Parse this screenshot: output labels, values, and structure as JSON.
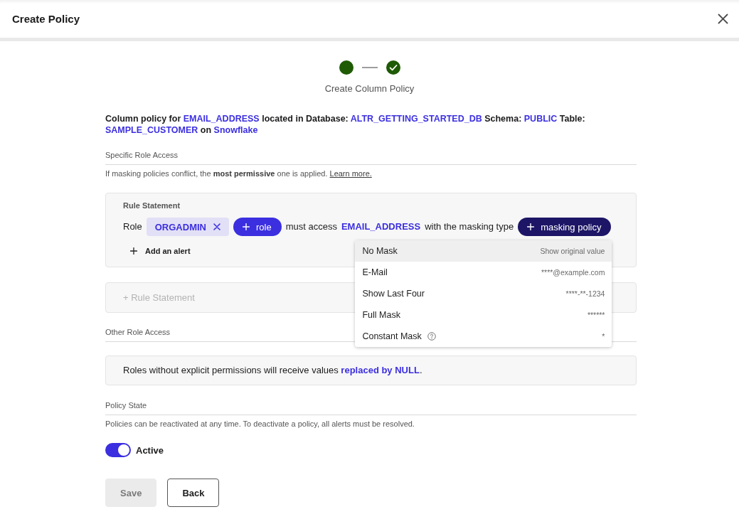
{
  "dialog": {
    "title": "Create Policy"
  },
  "stepper": {
    "steps": [
      {
        "done": false
      },
      {
        "done": true
      }
    ],
    "caption": "Create Column Policy"
  },
  "summary": [
    {
      "kind": "text",
      "text": "Column policy for "
    },
    {
      "kind": "value",
      "text": "EMAIL_ADDRESS"
    },
    {
      "kind": "text",
      "text": " located in Database: "
    },
    {
      "kind": "value",
      "text": "ALTR_GETTING_STARTED_DB"
    },
    {
      "kind": "text",
      "text": " Schema: "
    },
    {
      "kind": "value",
      "text": "PUBLIC"
    },
    {
      "kind": "text",
      "text": " Table: "
    },
    {
      "kind": "value",
      "text": "SAMPLE_CUSTOMER"
    },
    {
      "kind": "text",
      "text": " on "
    },
    {
      "kind": "value",
      "text": "Snowflake"
    }
  ],
  "specific_role_access": {
    "heading": "Specific Role Access",
    "note": "If masking policies conflict, the **most permissive** one is applied.",
    "link": "Learn more.",
    "rule_statement": {
      "label": "Rule Statement",
      "sentence": [
        {
          "kind": "text",
          "text": "Role"
        },
        {
          "kind": "chip",
          "text": "ORGADMIN"
        },
        {
          "kind": "add",
          "text": "role",
          "expanded": false
        },
        {
          "kind": "text",
          "text": "must access"
        },
        {
          "kind": "value",
          "text": "EMAIL_ADDRESS"
        },
        {
          "kind": "text",
          "text": "with the masking type"
        },
        {
          "kind": "add",
          "text": "masking policy",
          "expanded": true,
          "menu": [
            {
              "label": "No Mask",
              "example": "Show original value",
              "highlighted": true,
              "help": false
            },
            {
              "label": "E-Mail",
              "example": "****@example.com",
              "highlighted": false,
              "help": false
            },
            {
              "label": "Show Last Four",
              "example": "****-**-1234",
              "highlighted": false,
              "help": false
            },
            {
              "label": "Full Mask",
              "example": "******",
              "highlighted": false,
              "help": false
            },
            {
              "label": "Constant Mask",
              "example": "*",
              "highlighted": false,
              "help": true
            }
          ]
        }
      ],
      "add_alert": "Add an alert"
    },
    "add_rule": {
      "label": "+ Rule Statement",
      "disabled": true
    }
  },
  "other_role_access": {
    "heading": "Other Role Access",
    "message": [
      {
        "kind": "text",
        "text": "Roles without explicit permissions will receive values "
      },
      {
        "kind": "value",
        "text": "replaced by NULL"
      },
      {
        "kind": "text",
        "text": "."
      }
    ]
  },
  "policy_state": {
    "heading": "Policy State",
    "note": "Policies can be reactivated at any time. To deactivate a policy, all alerts must be resolved.",
    "toggle": {
      "label": "Active",
      "on": true
    }
  },
  "buttons": [
    {
      "label": "Save",
      "kind": "primary",
      "disabled": true
    },
    {
      "label": "Back",
      "kind": "secondary",
      "disabled": false
    }
  ]
}
